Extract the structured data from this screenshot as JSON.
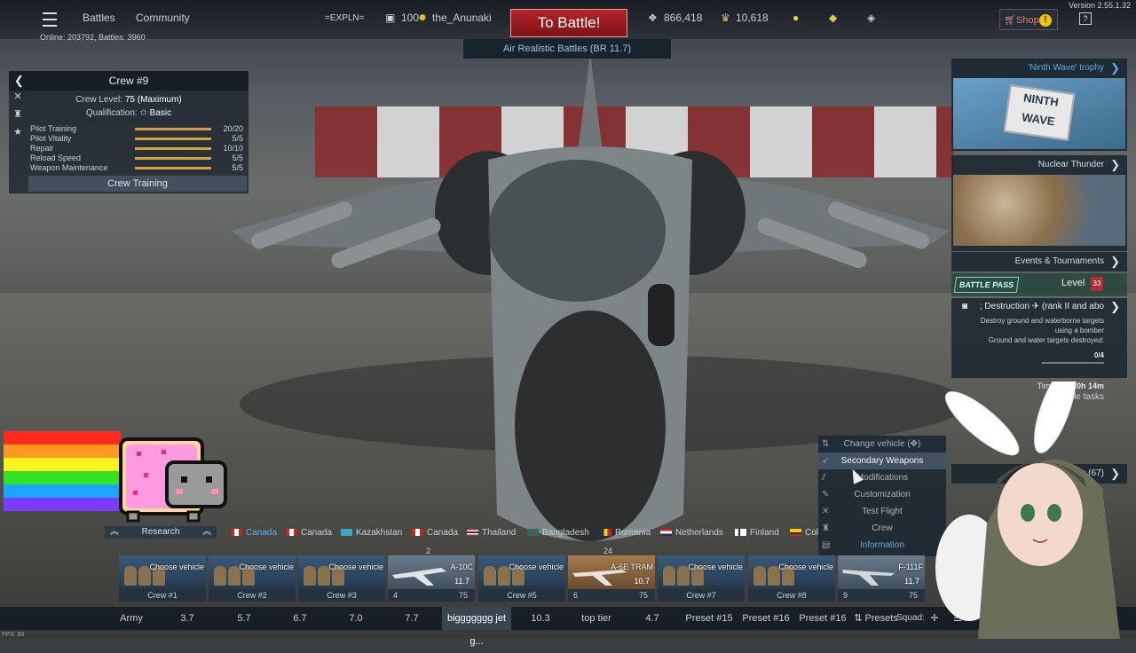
{
  "version": "Version 2.55.1.32",
  "online": "Online: 203792, Battles: 3960",
  "topbar": {
    "battles": "Battles",
    "community": "Community",
    "squadron": "=EXPLN=",
    "level": "100",
    "username": "the_Anunaki",
    "to_battle": "To Battle!",
    "mode": "Air Realistic Battles (BR 11.7)",
    "silver_lions": "866,418",
    "research_points": "10,618",
    "shop": "Shop",
    "shop_badge": "!",
    "help": "?"
  },
  "crew": {
    "title": "Crew #9",
    "level_label": "Crew Level:",
    "level_value": "75 (Maximum)",
    "qual_label": "Qualification:",
    "qual_value": "Basic",
    "skills": [
      {
        "name": "Pilot Training",
        "value": "20/20",
        "fill": 1.0
      },
      {
        "name": "Pilot Vitality",
        "value": "5/5",
        "fill": 1.0
      },
      {
        "name": "Repair",
        "value": "10/10",
        "fill": 1.0
      },
      {
        "name": "Reload Speed",
        "value": "5/5",
        "fill": 1.0
      },
      {
        "name": "Weapon Maintenance",
        "value": "5/5",
        "fill": 1.0
      }
    ],
    "training_button": "Crew Training"
  },
  "right_panel": {
    "trophy": "'Ninth Wave' trophy",
    "trophy_image_text": "NINTH WAVE",
    "nuclear": "Nuclear Thunder",
    "events": "Events & Tournaments",
    "battle_pass_badge": "BATTLE PASS",
    "level_label": "Level",
    "level_value": "33",
    "task_title": "; Destruction ✈ (rank II and abo",
    "task_desc_1": "Destroy ground and waterborne targets",
    "task_desc_2": "using a bomber",
    "task_desc_3": "Ground and water targets destroyed:",
    "task_progress": "0/4",
    "time_left_label": "Time left:",
    "time_left_value": "20h 14m",
    "battle_tasks": "battle tasks",
    "items": "ems (67)"
  },
  "context_menu": [
    {
      "label": "Change vehicle (✥)",
      "icon": "arrows-icon"
    },
    {
      "label": "Secondary Weapons",
      "icon": "weapons-icon"
    },
    {
      "label": "Modifications",
      "icon": "modifications-icon"
    },
    {
      "label": "Customization",
      "icon": "brush-icon"
    },
    {
      "label": "Test Flight",
      "icon": "test-flight-icon"
    },
    {
      "label": "Crew",
      "icon": "crew-icon"
    },
    {
      "label": "Information",
      "icon": "info-icon"
    }
  ],
  "research_tab": "Research",
  "countries": [
    {
      "name": "Canada",
      "selected": true
    },
    {
      "name": "Canada"
    },
    {
      "name": "Kazakhstan"
    },
    {
      "name": "Canada"
    },
    {
      "name": "Thailand"
    },
    {
      "name": "Bangladesh"
    },
    {
      "name": "Romania"
    },
    {
      "name": "Netherlands"
    },
    {
      "name": "Finland"
    },
    {
      "name": "Col"
    }
  ],
  "slots": [
    {
      "label": "Choose vehicle",
      "crew": "Crew #1"
    },
    {
      "label": "Choose vehicle",
      "crew": "Crew #2"
    },
    {
      "label": "Choose vehicle",
      "crew": "Crew #3"
    },
    {
      "label": "A-10C",
      "br": "11.7",
      "num": "4",
      "num2": "75",
      "count": "2"
    },
    {
      "label": "Choose vehicle",
      "crew": "Crew #5"
    },
    {
      "label": "A-6E TRAM",
      "br": "10.7",
      "num": "6",
      "num2": "75",
      "count": "24"
    },
    {
      "label": "Choose vehicle",
      "crew": "Crew #7"
    },
    {
      "label": "Choose vehicle",
      "crew": "Crew #8"
    },
    {
      "label": "F-111F",
      "br": "11.7",
      "num": "9",
      "num2": "75"
    }
  ],
  "presets": [
    "Army",
    "3.7",
    "5.7",
    "6.7",
    "7.0",
    "7.7",
    "biggggggg jet g...",
    "10.3",
    "top tier",
    "4.7",
    "Preset #15",
    "Preset #16",
    "Preset #16",
    "Presets",
    "Squad:"
  ],
  "fps": "FPS: 60",
  "colors": {
    "accent_blue": "#5da9e6",
    "battle_red": "#b3242a",
    "skill_bar": "#d7a23d"
  }
}
